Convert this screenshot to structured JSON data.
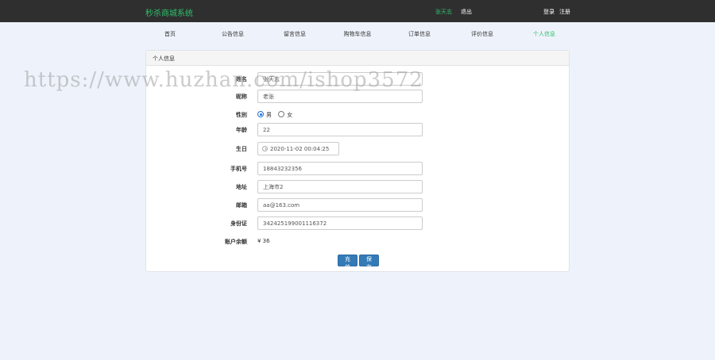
{
  "header": {
    "brand": "秒杀商城系统",
    "user": "张天志",
    "logout": "退出",
    "login": "登录",
    "register": "注册"
  },
  "nav": {
    "items": [
      "首页",
      "公告信息",
      "留言信息",
      "购物车信息",
      "订单信息",
      "评价信息",
      "个人信息"
    ],
    "active": "个人信息"
  },
  "panel": {
    "title": "个人信息",
    "fields": {
      "name": {
        "label": "姓名",
        "value": "张天志"
      },
      "nickname": {
        "label": "昵称",
        "value": "老张"
      },
      "gender": {
        "label": "性别",
        "options": [
          "男",
          "女"
        ],
        "selected": "男"
      },
      "age": {
        "label": "年龄",
        "value": "22"
      },
      "birthday": {
        "label": "生日",
        "value": "2020-11-02 00:04:25"
      },
      "phone": {
        "label": "手机号",
        "value": "18843232356"
      },
      "address": {
        "label": "地址",
        "value": "上海市2"
      },
      "email": {
        "label": "邮箱",
        "value": "aa@163.com"
      },
      "idcard": {
        "label": "身份证",
        "value": "342425199001116372"
      },
      "balance": {
        "label": "账户余额",
        "value": "¥ 36"
      }
    },
    "buttons": {
      "charge": "充值",
      "save": "保存"
    }
  },
  "watermark": "https://www.huzhan.com/ishop3572",
  "colors": {
    "topbar": "#2f2f2f",
    "accent": "#2fbf6a",
    "button": "#337ab7"
  }
}
